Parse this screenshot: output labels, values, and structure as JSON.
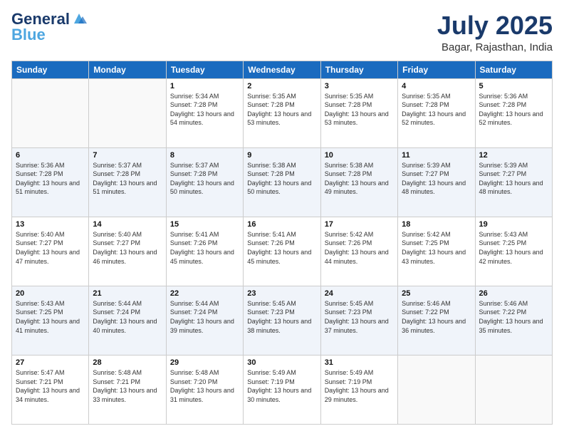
{
  "logo": {
    "text_general": "General",
    "text_blue": "Blue"
  },
  "header": {
    "title": "July 2025",
    "subtitle": "Bagar, Rajasthan, India"
  },
  "weekdays": [
    "Sunday",
    "Monday",
    "Tuesday",
    "Wednesday",
    "Thursday",
    "Friday",
    "Saturday"
  ],
  "weeks": [
    [
      {
        "day": "",
        "info": ""
      },
      {
        "day": "",
        "info": ""
      },
      {
        "day": "1",
        "info": "Sunrise: 5:34 AM\nSunset: 7:28 PM\nDaylight: 13 hours and 54 minutes."
      },
      {
        "day": "2",
        "info": "Sunrise: 5:35 AM\nSunset: 7:28 PM\nDaylight: 13 hours and 53 minutes."
      },
      {
        "day": "3",
        "info": "Sunrise: 5:35 AM\nSunset: 7:28 PM\nDaylight: 13 hours and 53 minutes."
      },
      {
        "day": "4",
        "info": "Sunrise: 5:35 AM\nSunset: 7:28 PM\nDaylight: 13 hours and 52 minutes."
      },
      {
        "day": "5",
        "info": "Sunrise: 5:36 AM\nSunset: 7:28 PM\nDaylight: 13 hours and 52 minutes."
      }
    ],
    [
      {
        "day": "6",
        "info": "Sunrise: 5:36 AM\nSunset: 7:28 PM\nDaylight: 13 hours and 51 minutes."
      },
      {
        "day": "7",
        "info": "Sunrise: 5:37 AM\nSunset: 7:28 PM\nDaylight: 13 hours and 51 minutes."
      },
      {
        "day": "8",
        "info": "Sunrise: 5:37 AM\nSunset: 7:28 PM\nDaylight: 13 hours and 50 minutes."
      },
      {
        "day": "9",
        "info": "Sunrise: 5:38 AM\nSunset: 7:28 PM\nDaylight: 13 hours and 50 minutes."
      },
      {
        "day": "10",
        "info": "Sunrise: 5:38 AM\nSunset: 7:28 PM\nDaylight: 13 hours and 49 minutes."
      },
      {
        "day": "11",
        "info": "Sunrise: 5:39 AM\nSunset: 7:27 PM\nDaylight: 13 hours and 48 minutes."
      },
      {
        "day": "12",
        "info": "Sunrise: 5:39 AM\nSunset: 7:27 PM\nDaylight: 13 hours and 48 minutes."
      }
    ],
    [
      {
        "day": "13",
        "info": "Sunrise: 5:40 AM\nSunset: 7:27 PM\nDaylight: 13 hours and 47 minutes."
      },
      {
        "day": "14",
        "info": "Sunrise: 5:40 AM\nSunset: 7:27 PM\nDaylight: 13 hours and 46 minutes."
      },
      {
        "day": "15",
        "info": "Sunrise: 5:41 AM\nSunset: 7:26 PM\nDaylight: 13 hours and 45 minutes."
      },
      {
        "day": "16",
        "info": "Sunrise: 5:41 AM\nSunset: 7:26 PM\nDaylight: 13 hours and 45 minutes."
      },
      {
        "day": "17",
        "info": "Sunrise: 5:42 AM\nSunset: 7:26 PM\nDaylight: 13 hours and 44 minutes."
      },
      {
        "day": "18",
        "info": "Sunrise: 5:42 AM\nSunset: 7:25 PM\nDaylight: 13 hours and 43 minutes."
      },
      {
        "day": "19",
        "info": "Sunrise: 5:43 AM\nSunset: 7:25 PM\nDaylight: 13 hours and 42 minutes."
      }
    ],
    [
      {
        "day": "20",
        "info": "Sunrise: 5:43 AM\nSunset: 7:25 PM\nDaylight: 13 hours and 41 minutes."
      },
      {
        "day": "21",
        "info": "Sunrise: 5:44 AM\nSunset: 7:24 PM\nDaylight: 13 hours and 40 minutes."
      },
      {
        "day": "22",
        "info": "Sunrise: 5:44 AM\nSunset: 7:24 PM\nDaylight: 13 hours and 39 minutes."
      },
      {
        "day": "23",
        "info": "Sunrise: 5:45 AM\nSunset: 7:23 PM\nDaylight: 13 hours and 38 minutes."
      },
      {
        "day": "24",
        "info": "Sunrise: 5:45 AM\nSunset: 7:23 PM\nDaylight: 13 hours and 37 minutes."
      },
      {
        "day": "25",
        "info": "Sunrise: 5:46 AM\nSunset: 7:22 PM\nDaylight: 13 hours and 36 minutes."
      },
      {
        "day": "26",
        "info": "Sunrise: 5:46 AM\nSunset: 7:22 PM\nDaylight: 13 hours and 35 minutes."
      }
    ],
    [
      {
        "day": "27",
        "info": "Sunrise: 5:47 AM\nSunset: 7:21 PM\nDaylight: 13 hours and 34 minutes."
      },
      {
        "day": "28",
        "info": "Sunrise: 5:48 AM\nSunset: 7:21 PM\nDaylight: 13 hours and 33 minutes."
      },
      {
        "day": "29",
        "info": "Sunrise: 5:48 AM\nSunset: 7:20 PM\nDaylight: 13 hours and 31 minutes."
      },
      {
        "day": "30",
        "info": "Sunrise: 5:49 AM\nSunset: 7:19 PM\nDaylight: 13 hours and 30 minutes."
      },
      {
        "day": "31",
        "info": "Sunrise: 5:49 AM\nSunset: 7:19 PM\nDaylight: 13 hours and 29 minutes."
      },
      {
        "day": "",
        "info": ""
      },
      {
        "day": "",
        "info": ""
      }
    ]
  ]
}
